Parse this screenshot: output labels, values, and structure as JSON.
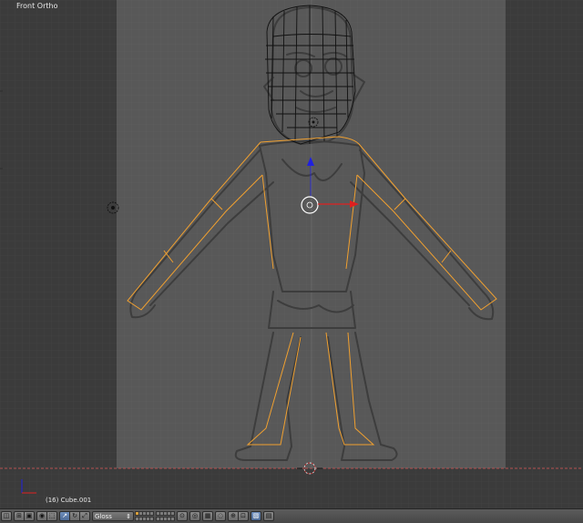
{
  "viewport": {
    "view_label": "Front Ortho",
    "object_label": "(16) Cube.001"
  },
  "header": {
    "view_menu_icon": "view-menu-icon",
    "mode_select_value": "Gloss",
    "buttons": [
      {
        "name": "editor-type-button",
        "glyph": "◫"
      },
      {
        "name": "menu-toggle-button",
        "glyph": "⊞"
      },
      {
        "name": "object-mode-icon",
        "glyph": "▣"
      },
      {
        "name": "pivot-icon",
        "glyph": "◉"
      },
      {
        "name": "snap-icon",
        "glyph": "⬚"
      },
      {
        "name": "manipulator-translate-button",
        "glyph": "↗"
      },
      {
        "name": "manipulator-rotate-button",
        "glyph": "↻"
      },
      {
        "name": "manipulator-scale-button",
        "glyph": "⤢"
      }
    ],
    "right_buttons": [
      {
        "name": "lock-layers-button",
        "glyph": "⊙"
      },
      {
        "name": "camera-view-button",
        "glyph": "◎"
      },
      {
        "name": "render-button",
        "glyph": "▦"
      },
      {
        "name": "proportional-edit-button",
        "glyph": "◌"
      },
      {
        "name": "snap-toggle-button",
        "glyph": "⊕"
      },
      {
        "name": "snap-element-button",
        "glyph": "⊡"
      },
      {
        "name": "render-preview-button",
        "glyph": "▧"
      },
      {
        "name": "opengl-render-button",
        "glyph": "▤"
      }
    ]
  },
  "colors": {
    "viewport_bg": "#3b3b3b",
    "camera_bg": "#575757",
    "selection_outline": "#f0a030",
    "x_axis": "#e02020",
    "z_axis": "#2020e0"
  }
}
